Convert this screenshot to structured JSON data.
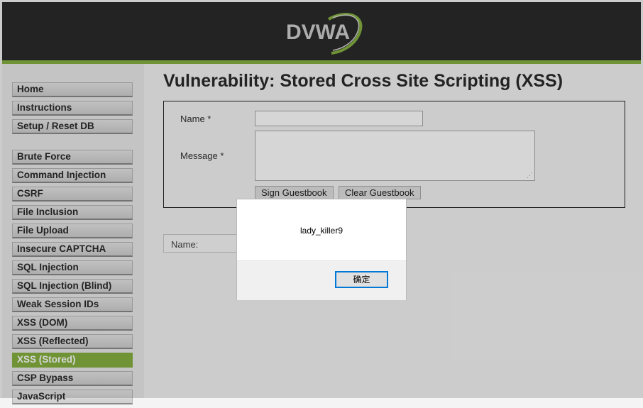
{
  "header": {
    "logo_text": "DVWA",
    "accent_color": "#86b140"
  },
  "menu": {
    "top_items": [
      {
        "label": "Home"
      },
      {
        "label": "Instructions"
      },
      {
        "label": "Setup / Reset DB"
      }
    ],
    "vuln_items": [
      {
        "label": "Brute Force"
      },
      {
        "label": "Command Injection"
      },
      {
        "label": "CSRF"
      },
      {
        "label": "File Inclusion"
      },
      {
        "label": "File Upload"
      },
      {
        "label": "Insecure CAPTCHA"
      },
      {
        "label": "SQL Injection"
      },
      {
        "label": "SQL Injection (Blind)"
      },
      {
        "label": "Weak Session IDs"
      },
      {
        "label": "XSS (DOM)"
      },
      {
        "label": "XSS (Reflected)"
      },
      {
        "label": "XSS (Stored)",
        "selected": true
      },
      {
        "label": "CSP Bypass"
      },
      {
        "label": "JavaScript"
      }
    ]
  },
  "main": {
    "title": "Vulnerability: Stored Cross Site Scripting (XSS)",
    "form": {
      "name_label": "Name *",
      "message_label": "Message *",
      "name_value": "",
      "message_value": "",
      "sign_button": "Sign Guestbook",
      "clear_button": "Clear Guestbook"
    },
    "entry": {
      "name_label": "Name:"
    }
  },
  "dialog": {
    "message": "lady_killer9",
    "ok_label": "确定"
  }
}
